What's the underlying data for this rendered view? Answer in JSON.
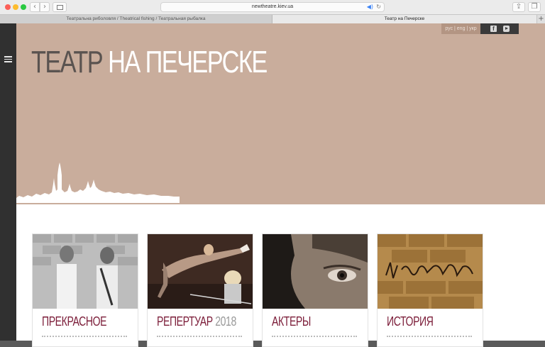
{
  "browser": {
    "url": "newtheatre.kiev.ua",
    "tabs": [
      {
        "label": "Театральна риболовля / Theatrical fishing / Театральная рыбалка",
        "active": false
      },
      {
        "label": "Театр на Печерске",
        "active": true
      }
    ]
  },
  "site": {
    "title_part1": "ТЕАТР",
    "title_part2": "НА ПЕЧЕРСКЕ",
    "languages": "рус | eng | укр",
    "colors": {
      "hero": "#c9ad9c",
      "accent": "#7b1c38",
      "rail": "#303030"
    },
    "social": [
      "facebook-icon",
      "youtube-icon"
    ]
  },
  "cards": [
    {
      "title": "ПРЕКРАСНОЕ",
      "year": ""
    },
    {
      "title": "РЕПЕРТУАР",
      "year": "2018"
    },
    {
      "title": "АКТЕРЫ",
      "year": ""
    },
    {
      "title": "ИСТОРИЯ",
      "year": ""
    }
  ]
}
